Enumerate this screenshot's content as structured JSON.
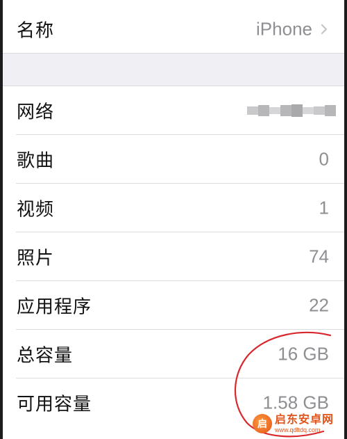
{
  "header_row": {
    "label": "名称",
    "value": "iPhone",
    "chevron_icon": "chevron-right-icon"
  },
  "rows": [
    {
      "key": "network",
      "label": "网络",
      "value": ""
    },
    {
      "key": "songs",
      "label": "歌曲",
      "value": "0"
    },
    {
      "key": "videos",
      "label": "视频",
      "value": "1"
    },
    {
      "key": "photos",
      "label": "照片",
      "value": "74"
    },
    {
      "key": "apps",
      "label": "应用程序",
      "value": "22"
    },
    {
      "key": "capacity",
      "label": "总容量",
      "value": "16 GB"
    },
    {
      "key": "available",
      "label": "可用容量",
      "value": "1.58 GB"
    }
  ],
  "annotation": {
    "shape": "circle",
    "color": "#d9272e"
  },
  "watermark": {
    "title": "启东安卓网",
    "url": "www.qdltdq.com",
    "logo_text": "启",
    "color": "#e2531a"
  },
  "colors": {
    "background": "#efeff4",
    "cell": "#ffffff",
    "label": "#111111",
    "value": "#8e8e93",
    "separator": "#dcdce0"
  }
}
